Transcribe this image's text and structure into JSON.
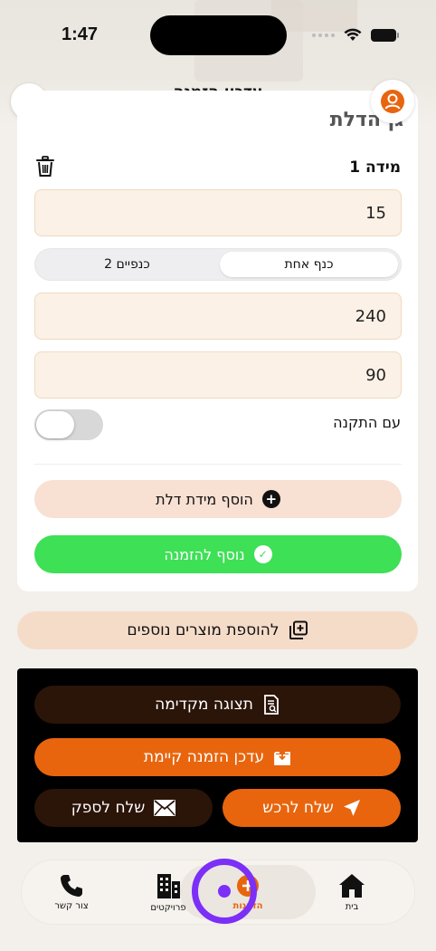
{
  "status": {
    "time": "1:47"
  },
  "header": {
    "title": "עדכון הזמנה",
    "help_icon": "question-mark-icon",
    "profile_icon": "user-icon"
  },
  "card": {
    "title": "גן הדלת",
    "measure_label": "1 מידה",
    "field_1": "15",
    "segment": {
      "selected": "כנף אחת",
      "other": "2 כנפיים"
    },
    "field_2": "240",
    "field_3": "90",
    "installation_label": "עם התקנה",
    "installation_on": false,
    "add_measure": "הוסף מידת דלת",
    "added_to_order": "נוסף להזמנה"
  },
  "extra_products": "להוספת מוצרים נוספים",
  "actions": {
    "preview": "תצוגה מקדימה",
    "update_existing": "עדכן הזמנה קיימת",
    "send_buyer": "שלח לרכש",
    "send_supplier": "שלח לספק"
  },
  "tabbar": {
    "home": "בית",
    "orders": "הזמנות",
    "projects": "פרויקטים",
    "contact": "צור קשר"
  },
  "colors": {
    "accent": "#e8650e",
    "success": "#3ee056",
    "touch": "#7b2ff7"
  }
}
